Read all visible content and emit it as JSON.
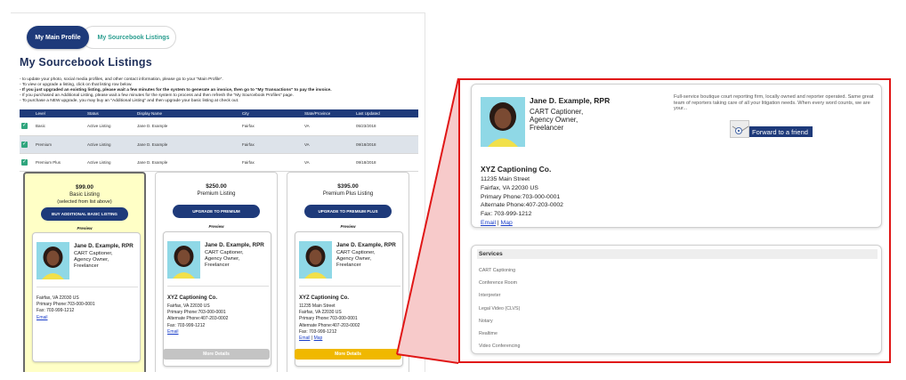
{
  "tabs": {
    "main_profile": "My Main Profile",
    "sourcebook_listings": "My Sourcebook Listings"
  },
  "page_title": "My Sourcebook Listings",
  "instructions": [
    "- to update your photo, social media profiles, and other contact information, please go to your \"Main Profile\".",
    "- To view or upgrade a listing, click on that listing row below.",
    "- If you just upgraded an existing listing, please wait a few minutes for the system to generate an invoice, then go to \"My Transactions\" to pay the invoice.",
    "- If you purchased an Additional Listing, please wait a few minutes for the system to process and then refresh the \"My Sourcebook Profiles\" page.",
    "- To purchase a NEW upgrade, you may buy an \"Additional Listing\" and then upgrade your basic listing at check out."
  ],
  "table": {
    "headers": [
      "",
      "Level",
      "Status",
      "Display Name",
      "City",
      "State/Province",
      "Last Updated"
    ],
    "rows": [
      {
        "level": "Basic",
        "status": "Active Listing",
        "name": "Jane D. Example",
        "city": "Fairfax",
        "state": "VA",
        "updated": "05/23/2018"
      },
      {
        "level": "Premium",
        "status": "Active Listing",
        "name": "Jane D. Example",
        "city": "Fairfax",
        "state": "VA",
        "updated": "09/18/2018"
      },
      {
        "level": "Premium Plus",
        "status": "Active Listing",
        "name": "Jane D. Example",
        "city": "Fairfax",
        "state": "VA",
        "updated": "09/18/2018"
      }
    ]
  },
  "cards": {
    "basic": {
      "price": "$99.00",
      "tier": "Basic Listing",
      "tier_sub": "(selected from list above)",
      "button": "BUY ADDITIONAL BASIC LISTING",
      "preview": "Preview",
      "name": "Jane D. Example, RPR",
      "titles": [
        "CART Captioner,",
        "Agency Owner,",
        "Freelancer"
      ],
      "lines": [
        "Fairfax, VA 22030 US",
        "Primary Phone:703-000-0001",
        "Fax: 703-999-1212"
      ],
      "email": "Email"
    },
    "premium": {
      "price": "$250.00",
      "tier": "Premium Listing",
      "button": "UPGRADE TO PREMIUM",
      "preview": "Preview",
      "name": "Jane D. Example, RPR",
      "titles": [
        "CART Captioner,",
        "Agency Owner,",
        "Freelancer"
      ],
      "company": "XYZ Captioning Co.",
      "lines": [
        "Fairfax, VA 22030 US",
        "Primary Phone:703-000-0001",
        "Alternate Phone:407-203-0002",
        "Fax: 703-999-1212"
      ],
      "email": "Email",
      "more": "More Details"
    },
    "plus": {
      "price": "$395.00",
      "tier": "Premium Plus Listing",
      "button": "UPGRADE TO PREMIUM PLUS",
      "preview": "Preview",
      "name": "Jane D. Example, RPR",
      "titles": [
        "CART Captioner,",
        "Agency Owner,",
        "Freelancer"
      ],
      "company": "XYZ Captioning Co.",
      "lines": [
        "11235 Main Street",
        "Fairfax, VA 22030 US",
        "Primary Phone:703-000-0001",
        "Alternate Phone:407-203-0002",
        "Fax: 703-999-1212"
      ],
      "email": "Email",
      "separator": "|",
      "map": "Map",
      "more": "More Details"
    }
  },
  "zoom": {
    "name": "Jane D. Example, RPR",
    "titles": [
      "CART Captioner,",
      "Agency Owner,",
      "Freelancer"
    ],
    "description": "Full-service boutique court reporting firm, locally owned and reporter operated. Same great team of reporters taking care of all your litigation needs. When every word counts, we are your...",
    "forward": "Forward to a friend",
    "company": "XYZ Captioning Co.",
    "lines": [
      "11235 Main Street",
      "Fairfax, VA 22030 US",
      "Primary Phone:703-000-0001",
      "Alternate Phone:407-203-0002",
      "Fax: 703-999-1212"
    ],
    "email": "Email",
    "separator": "|",
    "map": "Map",
    "services_title": "Services",
    "services": [
      "CART Captioning",
      "Conference Room",
      "Interpreter",
      "Legal Video (CLVS)",
      "Notary",
      "Realtime",
      "Video Conferencing"
    ]
  },
  "colors": {
    "navy": "#1e3a7a",
    "teal": "#2a9d8f",
    "check_green": "#2fa57d",
    "highlight_yellow": "#ffffc6",
    "gold_button": "#f0b800",
    "gray_button": "#c4c4c4",
    "callout_red": "#e01616"
  },
  "icons": {
    "check": "check-icon",
    "forward": "envelope-at-icon"
  }
}
